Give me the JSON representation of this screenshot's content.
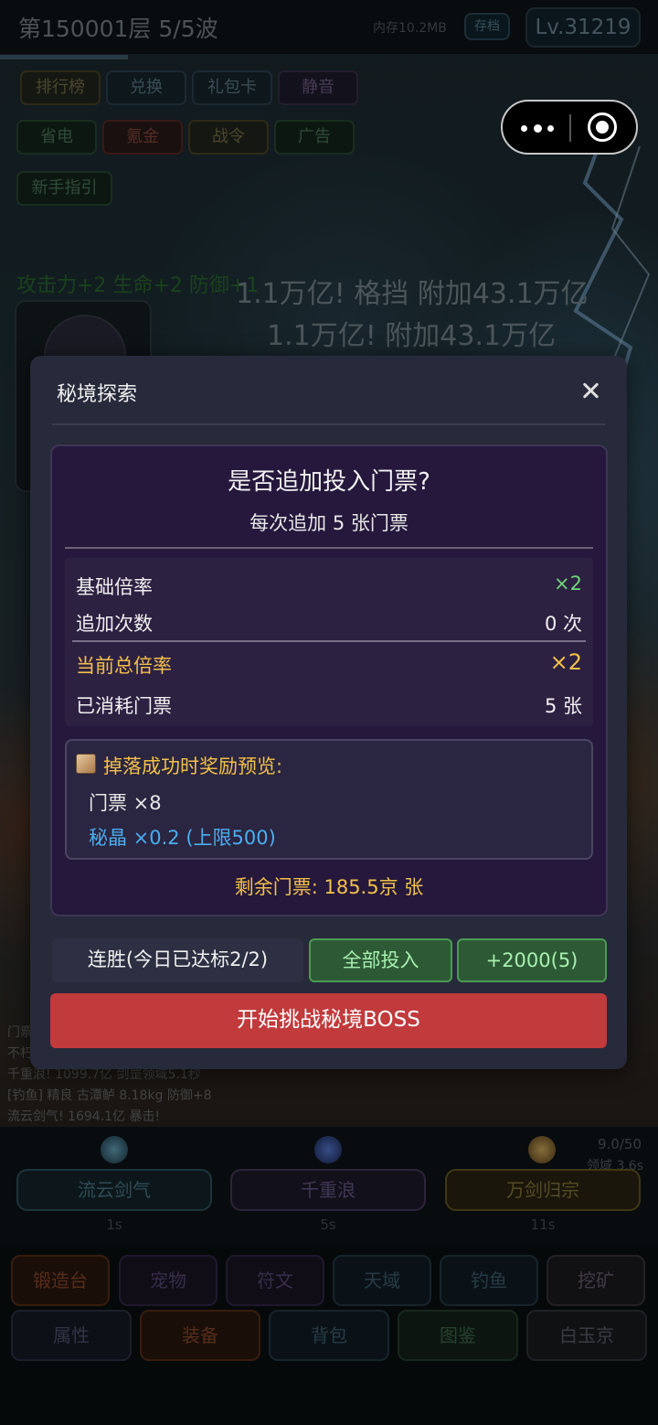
{
  "header": {
    "stage": "第150001层  5/5波",
    "memory": "内存10.2MB",
    "save_label": "存档",
    "level": "Lv.31219"
  },
  "menu_row1": [
    "排行榜",
    "兑换",
    "礼包卡",
    "静音"
  ],
  "menu_row2": [
    "省电",
    "氪金",
    "战令",
    "广告"
  ],
  "menu_row3": [
    "新手指引"
  ],
  "battle": {
    "buff_text": "攻击力+2 生命+2 防御+1",
    "damage_line1": "1.1万亿! 格挡 附加43.1万亿",
    "damage_line2": "1.1万亿! 附加43.1万亿"
  },
  "log_lines": [
    "门票",
    "不朽",
    "千重浪! 1099.7亿 剑罡领域5.1秒",
    "[钓鱼] 精良 古潭鲈 8.18kg 防御+8",
    "流云剑气! 1694.1亿 暴击!"
  ],
  "skills": [
    {
      "name": "流云剑气",
      "cooldown": "1s",
      "color": "#2a4a58"
    },
    {
      "name": "千重浪",
      "cooldown": "5s",
      "color": "#3a2a48"
    },
    {
      "name": "万剑归宗",
      "cooldown": "11s",
      "color": "#5a4a1a"
    }
  ],
  "skill_counter": "9.0/50",
  "skill_domain": "领域 3.6s",
  "tabs_row1": [
    "锻造台",
    "宠物",
    "符文",
    "天域",
    "钓鱼",
    "挖矿"
  ],
  "tabs_row2": [
    "属性",
    "装备",
    "背包",
    "图鉴",
    "白玉京"
  ],
  "modal": {
    "title": "秘境探索",
    "question": "是否追加投入门票?",
    "subtitle": "每次追加 5 张门票",
    "stats": {
      "base_rate_label": "基础倍率",
      "base_rate_value": "×2",
      "extra_count_label": "追加次数",
      "extra_count_value": "0 次",
      "total_rate_label": "当前总倍率",
      "total_rate_value": "×2",
      "consumed_label": "已消耗门票",
      "consumed_value": "5 张"
    },
    "reward": {
      "title": "掉落成功时奖励预览:",
      "ticket": "门票 ×8",
      "crystal": "秘晶 ×0.2 (上限500)"
    },
    "remaining": "剩余门票: 185.5京 张",
    "streak": "连胜(今日已达标2/2)",
    "all_in_label": "全部投入",
    "add_label": "+2000(5)",
    "start_label": "开始挑战秘境BOSS"
  },
  "colors": {
    "accent_gold": "#f2c04a",
    "accent_blue": "#4aaef0",
    "accent_green": "#6ed87a",
    "start_red": "#c13a3c"
  }
}
